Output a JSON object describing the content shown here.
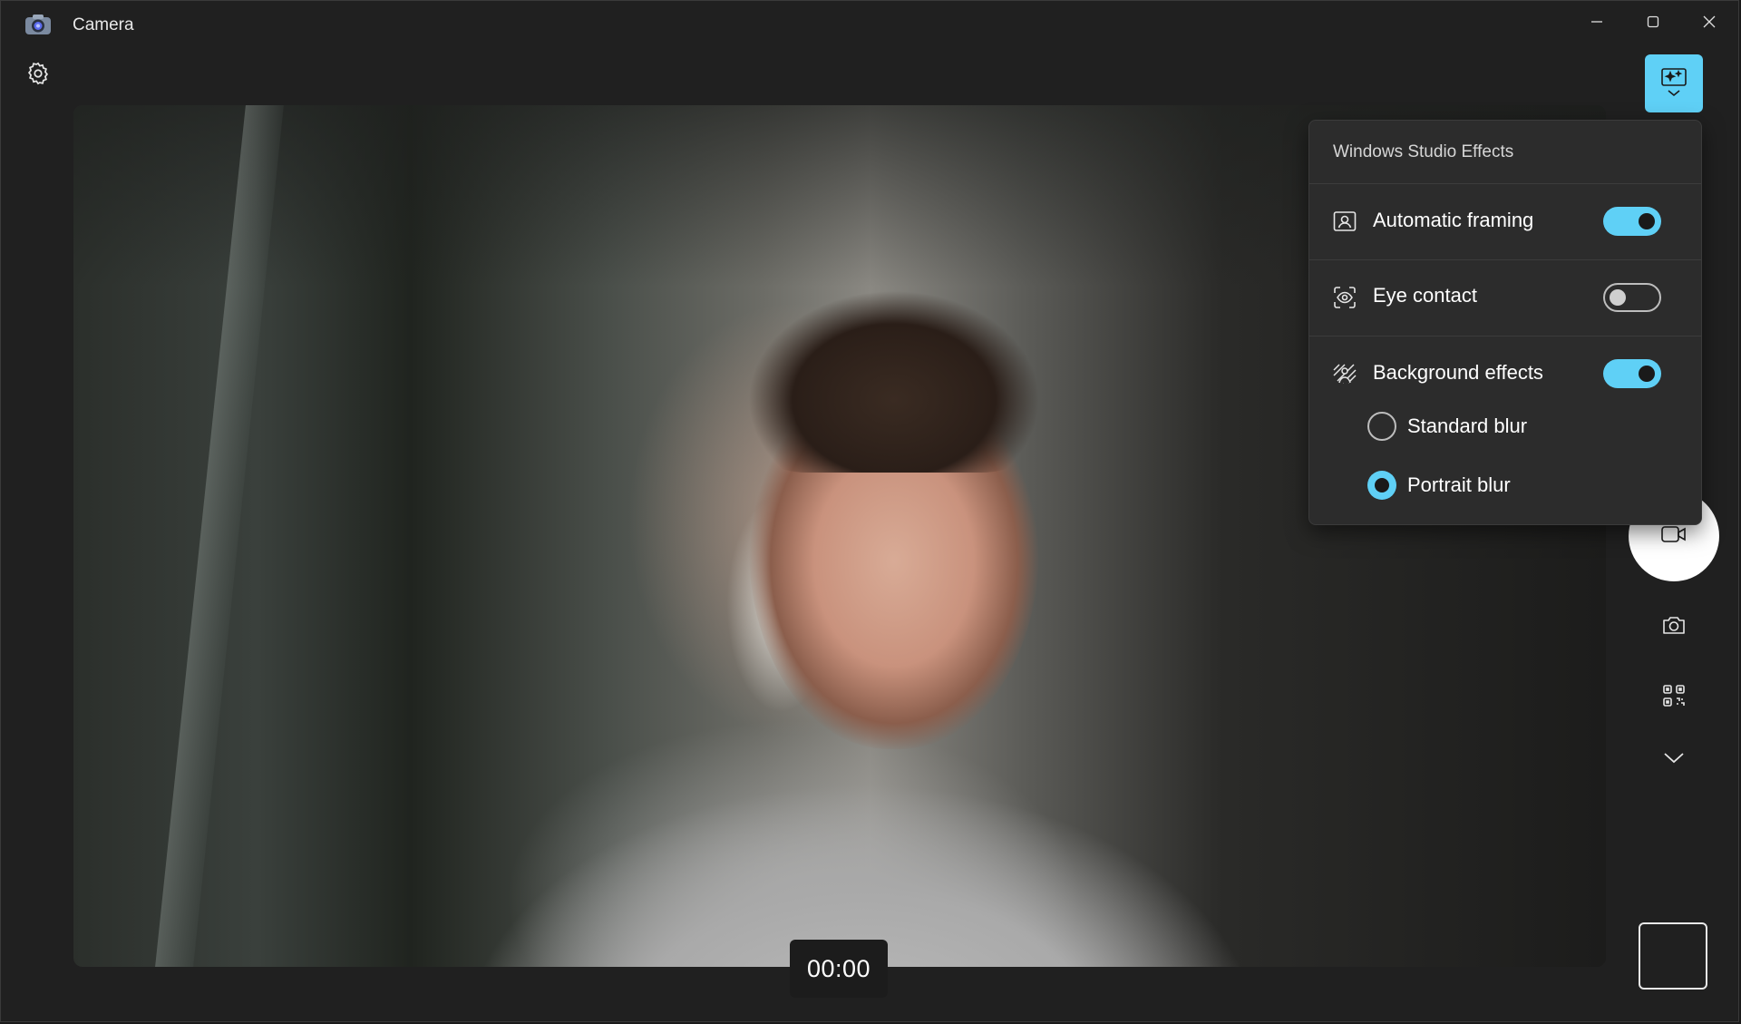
{
  "window": {
    "title": "Camera",
    "minimize_icon": "minimize-icon",
    "maximize_icon": "maximize-icon",
    "close_icon": "close-icon"
  },
  "toolbar": {
    "settings_icon": "gear-icon"
  },
  "viewfinder": {
    "timer": "00:00"
  },
  "studio_effects": {
    "title": "Windows Studio Effects",
    "automatic_framing": {
      "label": "Automatic framing",
      "enabled": true,
      "icon": "portrait-frame-icon"
    },
    "eye_contact": {
      "label": "Eye contact",
      "enabled": false,
      "icon": "eye-focus-icon"
    },
    "background_effects": {
      "label": "Background effects",
      "enabled": true,
      "icon": "background-blur-icon",
      "options": [
        {
          "label": "Standard blur",
          "selected": false
        },
        {
          "label": "Portrait blur",
          "selected": true
        }
      ]
    }
  },
  "controls": {
    "effects_button_icon": "sparkle-effects-icon",
    "video_shutter_icon": "video-camera-icon",
    "photo_mode_icon": "camera-icon",
    "qr_mode_icon": "qr-code-icon",
    "more_modes_icon": "chevron-down-icon"
  },
  "colors": {
    "accent": "#5fd0f6",
    "window_bg": "#202020",
    "flyout_bg": "#2c2c2c"
  }
}
